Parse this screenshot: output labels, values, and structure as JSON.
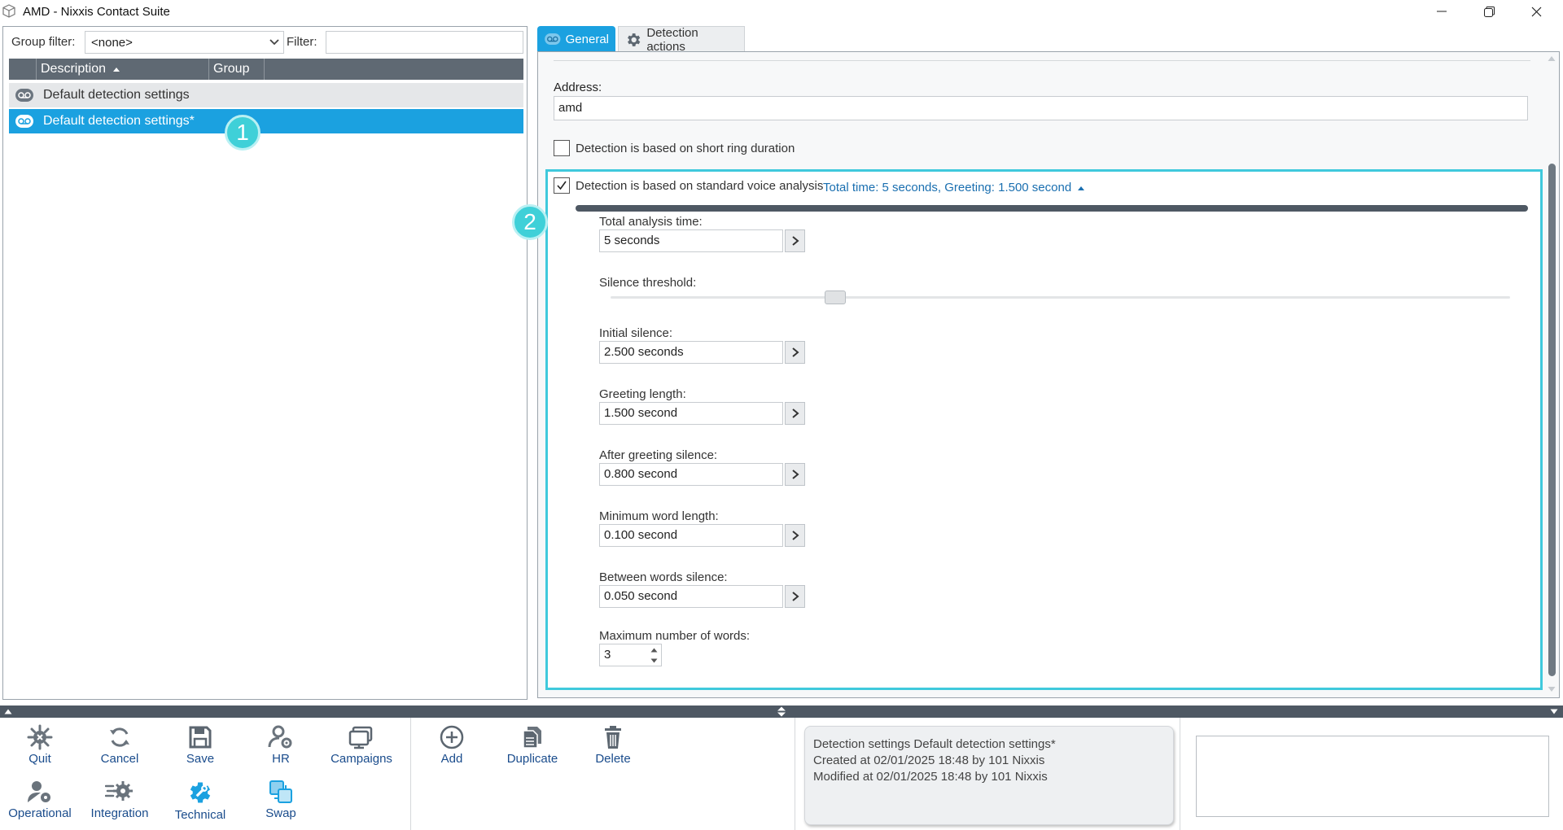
{
  "window": {
    "title": "AMD - Nixxis Contact Suite"
  },
  "left": {
    "group_filter_label": "Group filter:",
    "group_filter_value": "<none>",
    "filter_label": "Filter:",
    "filter_value": "",
    "columns": [
      "Description",
      "Group"
    ],
    "rows": [
      {
        "description": "Default detection settings"
      },
      {
        "description": "Default detection settings*"
      }
    ]
  },
  "badges": [
    "1",
    "2"
  ],
  "tabs": {
    "general": "General",
    "detection_actions": "Detection actions"
  },
  "form": {
    "address_label": "Address:",
    "address_value": "amd",
    "short_ring_label": "Detection is based on short ring duration",
    "short_ring_checked": false,
    "voice_label": "Detection is based on standard voice analysis",
    "voice_checked": true,
    "voice_summary": "Total time: 5 seconds, Greeting: 1.500 second",
    "total_analysis_label": "Total analysis time:",
    "total_analysis_value": "5 seconds",
    "silence_threshold_label": "Silence threshold:",
    "silence_threshold_level": 0.25,
    "initial_silence_label": "Initial silence:",
    "initial_silence_value": "2.500 seconds",
    "greeting_length_label": "Greeting length:",
    "greeting_length_value": "1.500 second",
    "after_greeting_label": "After greeting silence:",
    "after_greeting_value": "0.800 second",
    "min_word_label": "Minimum word length:",
    "min_word_value": "0.100 second",
    "between_words_label": "Between words silence:",
    "between_words_value": "0.050 second",
    "max_words_label": "Maximum number of words:",
    "max_words_value": "3"
  },
  "toolbar": {
    "quit": "Quit",
    "cancel": "Cancel",
    "save": "Save",
    "hr": "HR",
    "campaigns": "Campaigns",
    "operational": "Operational",
    "integration": "Integration",
    "technical": "Technical",
    "swap": "Swap",
    "add": "Add",
    "duplicate": "Duplicate",
    "delete": "Delete"
  },
  "info": {
    "line1": "Detection settings Default detection settings*",
    "line2": "Created at 02/01/2025 18:48 by 101 Nixxis",
    "line3": "Modified at 02/01/2025 18:48 by 101 Nixxis"
  },
  "colors": {
    "accent": "#1ba1e0",
    "badge": "#3fd0d8",
    "header": "#5f6973"
  }
}
